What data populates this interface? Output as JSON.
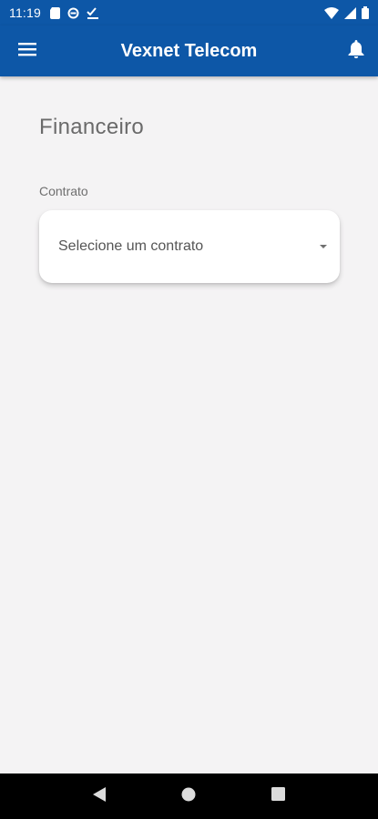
{
  "status_bar": {
    "time": "11:19",
    "left_icons": [
      "sim-card-icon",
      "data-saver-icon",
      "checklist-icon"
    ],
    "right_icons": [
      "wifi-icon",
      "signal-icon",
      "battery-icon"
    ]
  },
  "app_bar": {
    "title": "Vexnet Telecom",
    "menu_icon": "hamburger-menu-icon",
    "notification_icon": "bell-icon",
    "color": "#0d57a7"
  },
  "page": {
    "title": "Financeiro",
    "contract_label": "Contrato",
    "contract_select": {
      "placeholder": "Selecione um contrato"
    }
  },
  "nav_bar": {
    "buttons": [
      "back-triangle-icon",
      "home-circle-icon",
      "recents-square-icon"
    ]
  }
}
